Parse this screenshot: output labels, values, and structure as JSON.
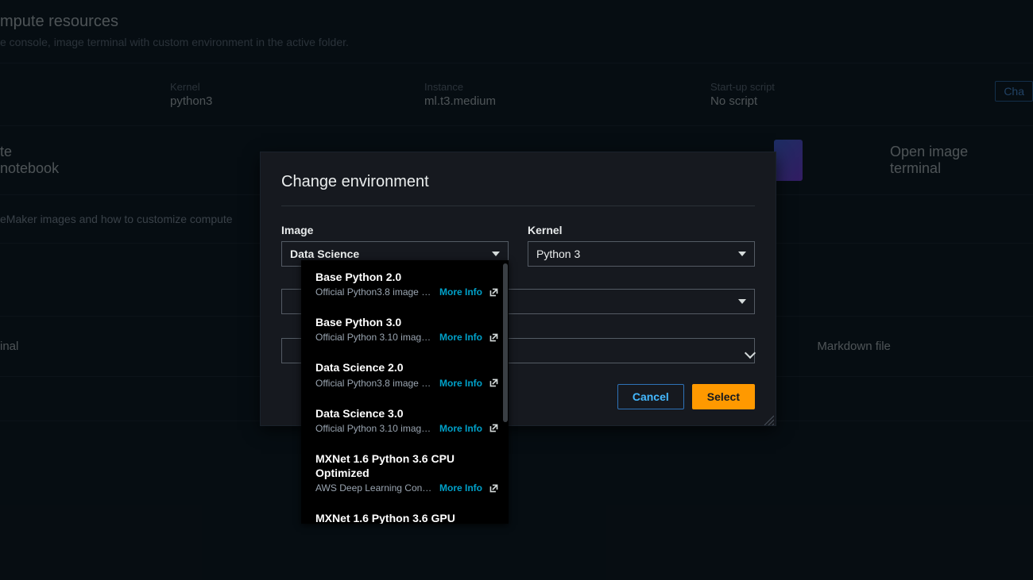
{
  "header": {
    "title_fragment": "mpute resources",
    "subtitle_fragment": "e console, image terminal with custom environment in the active folder."
  },
  "env_bar": {
    "kernel_label": "Kernel",
    "kernel_value": "python3",
    "instance_label": "Instance",
    "instance_value": "ml.t3.medium",
    "script_label": "Start-up script",
    "script_value": "No script",
    "change_label": "Cha"
  },
  "tiles": {
    "create_notebook": "te notebook",
    "open_image_terminal": "Open image terminal",
    "learn_more_fragment": "eMaker images and how to customize compute",
    "terminal_fragment": "inal",
    "markdown_file": "Markdown file"
  },
  "modal": {
    "title": "Change environment",
    "image_label": "Image",
    "image_value": "Data Science",
    "kernel_label": "Kernel",
    "kernel_value": "Python 3",
    "cancel": "Cancel",
    "select": "Select"
  },
  "dropdown": {
    "more_info": "More Info",
    "items": [
      {
        "title": "Base Python 2.0",
        "desc": "Official Python3.8 image f…"
      },
      {
        "title": "Base Python 3.0",
        "desc": "Official Python 3.10 imag…"
      },
      {
        "title": "Data Science 2.0",
        "desc": "Official Python3.8 image f…"
      },
      {
        "title": "Data Science 3.0",
        "desc": "Official Python 3.10 imag…"
      },
      {
        "title": "MXNet 1.6 Python 3.6 CPU Optimized",
        "desc": "AWS Deep Learning Conta…"
      },
      {
        "title": "MXNet 1.6 Python 3.6 GPU",
        "desc": ""
      }
    ]
  }
}
